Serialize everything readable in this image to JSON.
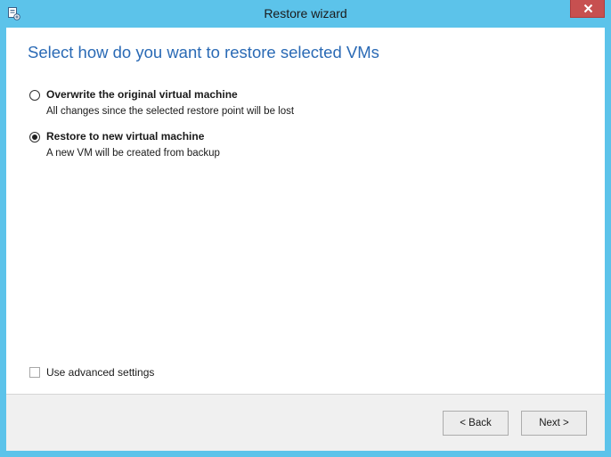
{
  "window": {
    "title": "Restore wizard",
    "app_icon": "wizard-window-icon",
    "close_icon": "close-icon"
  },
  "page": {
    "title": "Select how do you want to restore selected VMs"
  },
  "options": [
    {
      "label": "Overwrite the original virtual machine",
      "description": "All changes since the selected restore point will be lost",
      "selected": false
    },
    {
      "label": "Restore to new virtual machine",
      "description": "A new VM will be created from backup",
      "selected": true
    }
  ],
  "advanced": {
    "label": "Use advanced settings",
    "checked": false
  },
  "footer": {
    "back_label": "< Back",
    "next_label": "Next >"
  },
  "colors": {
    "frame": "#5cc3ea",
    "close_button": "#c75050",
    "title_text": "#2a6ab5",
    "footer_bg": "#f0f0f0"
  }
}
